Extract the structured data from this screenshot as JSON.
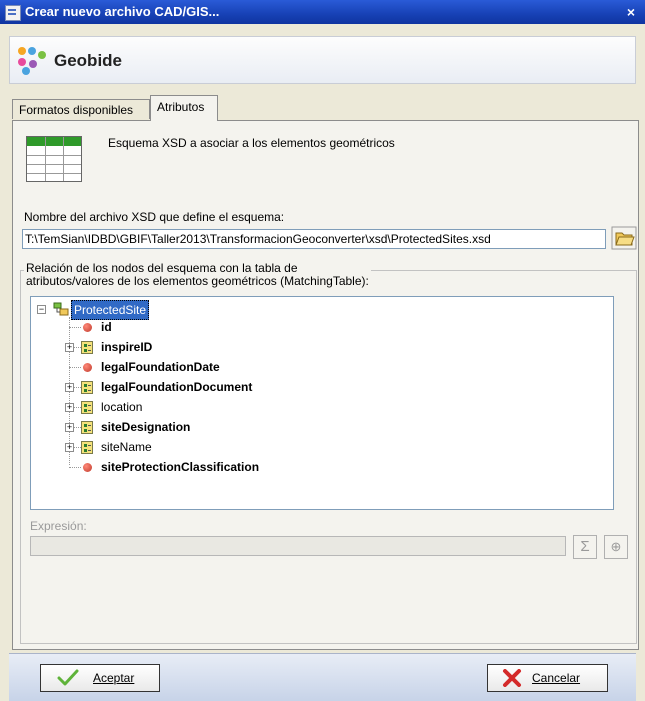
{
  "window": {
    "title": "Crear nuevo archivo CAD/GIS...",
    "close_glyph": "×"
  },
  "banner": {
    "brand": "Geobide"
  },
  "tabs": [
    {
      "label": "Formatos disponibles",
      "active": false
    },
    {
      "label": "Atributos",
      "active": true
    }
  ],
  "schema_section": {
    "description": "Esquema XSD a asociar a los elementos geométricos",
    "icon": "table-icon"
  },
  "xsd_file": {
    "label": "Nombre del archivo XSD que define el esquema:",
    "value": "T:\\TemSian\\IDBD\\GBIF\\Taller2013\\TransformacionGeoconverter\\xsd\\ProtectedSites.xsd",
    "browse_icon": "open-folder-icon"
  },
  "matching": {
    "title_line1": "Relación de los nodos del esquema con la tabla de",
    "title_line2": "atributos/valores de los elementos geométricos (MatchingTable):",
    "root": "ProtectedSite",
    "nodes": [
      {
        "label": "id",
        "bold": true,
        "kind": "attribute",
        "expandable": false
      },
      {
        "label": "inspireID",
        "bold": true,
        "kind": "complex",
        "expandable": true
      },
      {
        "label": "legalFoundationDate",
        "bold": true,
        "kind": "attribute",
        "expandable": false
      },
      {
        "label": "legalFoundationDocument",
        "bold": true,
        "kind": "complex",
        "expandable": true
      },
      {
        "label": "location",
        "bold": false,
        "kind": "complex",
        "expandable": true
      },
      {
        "label": "siteDesignation",
        "bold": true,
        "kind": "complex",
        "expandable": true
      },
      {
        "label": "siteName",
        "bold": false,
        "kind": "complex",
        "expandable": true
      },
      {
        "label": "siteProtectionClassification",
        "bold": true,
        "kind": "attribute",
        "expandable": false
      }
    ]
  },
  "expression": {
    "label": "Expresión:",
    "value": "",
    "sigma_glyph": "Σ",
    "add_glyph": "⊕"
  },
  "buttons": {
    "accept": {
      "label": "Aceptar",
      "icon": "checkmark-icon"
    },
    "cancel": {
      "label": "Cancelar",
      "icon": "red-x-icon"
    }
  },
  "colors": {
    "titlebar": "#1741b5",
    "selection": "#316ac5",
    "logo": [
      "#f6a623",
      "#e84b9c",
      "#4aa3df",
      "#7ac143",
      "#9b59b6"
    ]
  }
}
